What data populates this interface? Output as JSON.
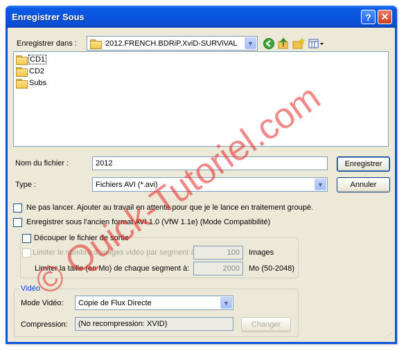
{
  "window": {
    "title": "Enregistrer Sous",
    "help_label": "?",
    "close_label": "✕"
  },
  "location": {
    "label": "Enregistrer dans :",
    "value": "2012.FRENCH.BDRiP.XviD-SURViVAL"
  },
  "toolbar": {
    "icons": [
      "back-icon",
      "up-folder-icon",
      "new-folder-icon",
      "view-menu-icon"
    ]
  },
  "files": [
    {
      "name": "CD1"
    },
    {
      "name": "CD2"
    },
    {
      "name": "Subs"
    }
  ],
  "filename": {
    "label": "Nom du fichier :",
    "value": "2012"
  },
  "type": {
    "label": "Type :",
    "value": "Fichiers AVI (*.avi)"
  },
  "buttons": {
    "save": "Enregistrer",
    "cancel": "Annuler",
    "change": "Changer"
  },
  "options": {
    "no_launch": "Ne pas lancer. Ajouter au travail en attente pour que je le lance en traitement groupé.",
    "old_format": "Enregistrer sous l'ancien format AVI 1.0 (VfW 1.1e) (Mode Compatibilité)",
    "split": "Découper le fichier de sortie",
    "limit_frames_label": "Limiter le nombre d'images vidéo par segment à",
    "limit_frames_value": "100",
    "limit_frames_unit": "Images",
    "limit_size_label": "Limiter la taille (en Mo) de chaque segment à:",
    "limit_size_value": "2000",
    "limit_size_unit": "Mo (50-2048)"
  },
  "video": {
    "group_label": "Vidéo",
    "mode_label": "Mode Vidéo:",
    "mode_value": "Copie de Flux Directe",
    "compression_label": "Compression:",
    "compression_value": "(No recompression: XVID)"
  },
  "watermark": "© Quick-Tutoriel.com",
  "colors": {
    "titlebar": "#0a54dc",
    "dialog_bg": "#ece9d8",
    "group_title": "#0046d5",
    "watermark": "#e62828"
  }
}
